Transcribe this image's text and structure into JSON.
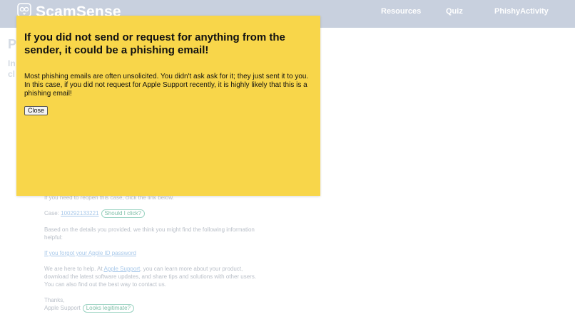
{
  "nav": {
    "brand": "ScamSense",
    "logo_icon": "owl-logo-icon",
    "links": [
      "Resources",
      "Quiz",
      "PhishyActivity"
    ]
  },
  "background": {
    "title_partial": "P",
    "intro_partial": [
      "In",
      "cl"
    ],
    "email": {
      "reopen": "If you need to reopen this case, click the link below.",
      "case_prefix": "Case: ",
      "case_link": "100292133221",
      "case_hint": "Should I click?",
      "details": "Based on the details you provided, we think you might find the following information helpful:",
      "forgot_link": "If you forgot your Apple ID password",
      "help_prefix": "We are here to help. At ",
      "help_link": "Apple Support",
      "help_suffix": ", you can learn more about your product, download the latest software updates, and share tips and solutions with other users. You can also find out the best way to contact us.",
      "thanks": "Thanks,",
      "signature": "Apple Support",
      "signature_hint": "Looks legitimate?"
    }
  },
  "modal": {
    "title": "If you did not send or request for anything from the sender, it could be a phishing email!",
    "text": "Most phishing emails are often unsolicited. You didn't ask ask for it; they just sent it to you. In this case, if you did not request for Apple Support recently, it is highly likely that this is a phishing email!",
    "close_label": "Close"
  },
  "colors": {
    "navbar": "#c8d0de",
    "modal": "#f8d64a",
    "hint_border": "#9bd3c2"
  }
}
